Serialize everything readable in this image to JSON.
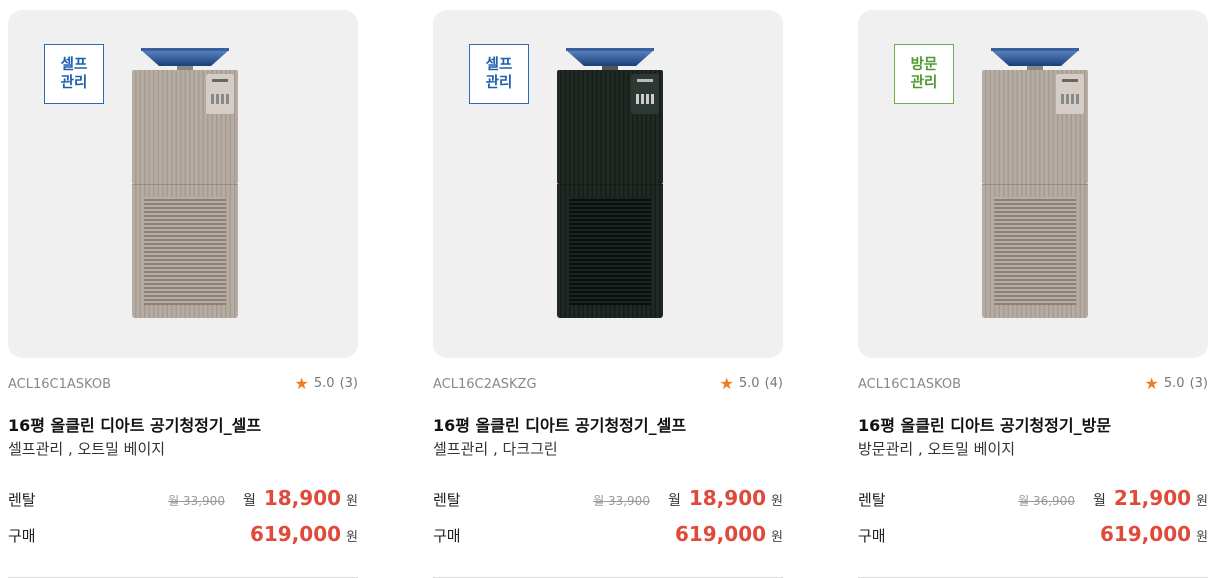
{
  "products": [
    {
      "badge_line1": "셀프",
      "badge_line2": "관리",
      "badge_type": "self",
      "color_variant": "oatmeal-beige",
      "model": "ACL16C1ASKOB",
      "rating": "5.0",
      "reviews": "(3)",
      "title": "16평 올클린 디아트 공기청정기_셀프",
      "option": "셀프관리 , 오트밀 베이지",
      "rent_label": "렌탈",
      "rent_original": "월 33,900",
      "rent_month": "월",
      "rent_price": "18,900",
      "rent_unit": "원",
      "buy_label": "구매",
      "buy_price": "619,000",
      "buy_unit": "원"
    },
    {
      "badge_line1": "셀프",
      "badge_line2": "관리",
      "badge_type": "self",
      "color_variant": "dark-green",
      "model": "ACL16C2ASKZG",
      "rating": "5.0",
      "reviews": "(4)",
      "title": "16평 올클린 디아트 공기청정기_셀프",
      "option": "셀프관리 , 다크그린",
      "rent_label": "렌탈",
      "rent_original": "월 33,900",
      "rent_month": "월",
      "rent_price": "18,900",
      "rent_unit": "원",
      "buy_label": "구매",
      "buy_price": "619,000",
      "buy_unit": "원"
    },
    {
      "badge_line1": "방문",
      "badge_line2": "관리",
      "badge_type": "visit",
      "color_variant": "oatmeal-beige",
      "model": "ACL16C1ASKOB",
      "rating": "5.0",
      "reviews": "(3)",
      "title": "16평 올클린 디아트 공기청정기_방문",
      "option": "방문관리 , 오트밀 베이지",
      "rent_label": "렌탈",
      "rent_original": "월 36,900",
      "rent_month": "월",
      "rent_price": "21,900",
      "rent_unit": "원",
      "buy_label": "구매",
      "buy_price": "619,000",
      "buy_unit": "원"
    }
  ],
  "colors": {
    "price": "#e04a3a",
    "star": "#ee7d22",
    "self_badge": "#1f5fae",
    "visit_badge": "#4f9a2f",
    "card_bg": "#f0f0f1"
  },
  "icons": {
    "rating": "star-icon"
  }
}
